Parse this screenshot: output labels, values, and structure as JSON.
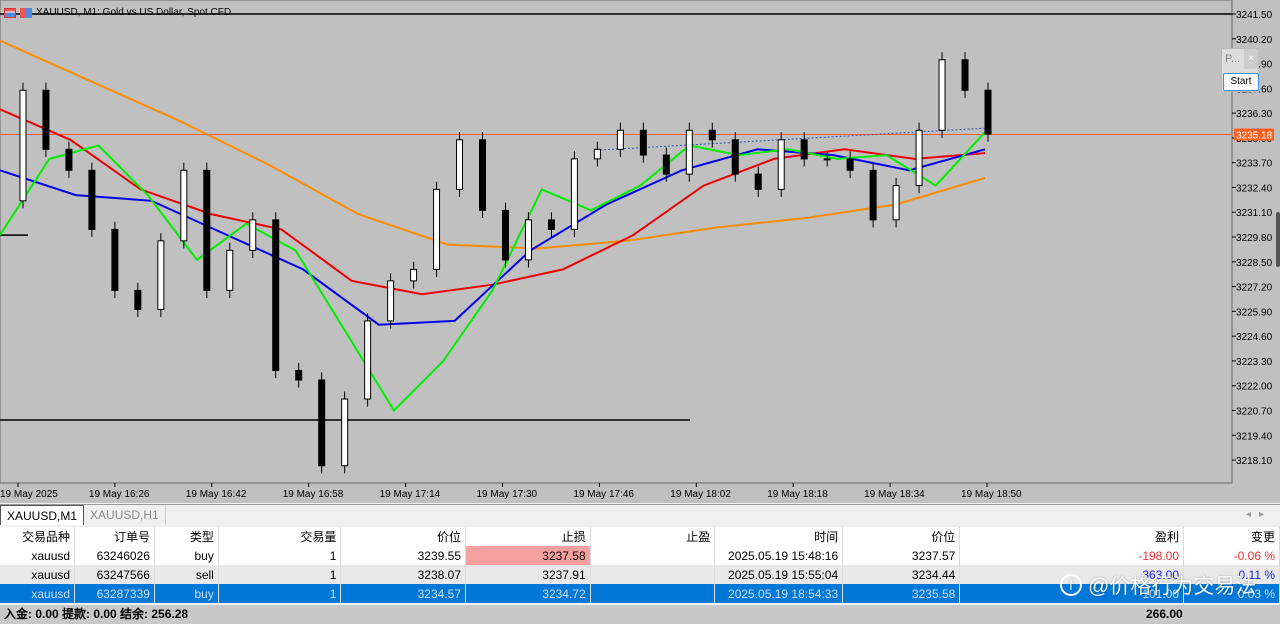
{
  "chart_title": "XAUUSD, M1:  Gold vs US Dollar, Spot CFD",
  "panel": {
    "title": "P...",
    "close": "×",
    "start": "Start"
  },
  "chart_data": {
    "type": "candlestick",
    "symbol": "XAUUSD",
    "timeframe": "M1",
    "ylim": [
      3217.5,
      3241.8
    ],
    "y_ticks": [
      "3241.50",
      "3240.20",
      "3238.90",
      "3237.60",
      "3236.30",
      "3235.00",
      "3233.70",
      "3232.40",
      "3231.10",
      "3229.80",
      "3228.50",
      "3227.20",
      "3225.90",
      "3224.60",
      "3223.30",
      "3222.00",
      "3220.70",
      "3219.40",
      "3218.10"
    ],
    "x_ticks": [
      "19 May 2025",
      "19 May 16:26",
      "19 May 16:42",
      "19 May 16:58",
      "19 May 17:14",
      "19 May 17:30",
      "19 May 17:46",
      "19 May 18:02",
      "19 May 18:18",
      "19 May 18:34",
      "19 May 18:50"
    ],
    "current_price": "3235.18",
    "closes": [
      3231.7,
      3237.5,
      3234.4,
      3233.3,
      3230.2,
      3227.0,
      3226.0,
      3229.6,
      3233.3,
      3227.0,
      3229.1,
      3230.7,
      3222.8,
      3222.3,
      3217.8,
      3221.3,
      3225.4,
      3227.5,
      3228.1,
      3232.3,
      3234.9,
      3231.2,
      3228.6,
      3230.7,
      3230.2,
      3233.9,
      3234.4,
      3235.4,
      3234.1,
      3233.1,
      3235.4,
      3234.9,
      3233.1,
      3232.3,
      3234.9,
      3233.9,
      3233.9,
      3233.3,
      3230.7,
      3232.5,
      3235.4,
      3239.1,
      3237.5,
      3235.2
    ],
    "moving_averages": [
      {
        "color": "#ff8c00",
        "values": [
          3240.1,
          3238.0,
          3235.9,
          3233.6,
          3231.0,
          3229.4,
          3229.2,
          3229.6,
          3230.3,
          3230.8,
          3231.5,
          3232.9
        ]
      },
      {
        "color": "#ee0000",
        "values": [
          3236.5,
          3234.9,
          3232.3,
          3231.0,
          3230.2,
          3227.5,
          3226.8,
          3227.3,
          3228.1,
          3229.9,
          3232.5,
          3233.9,
          3234.4,
          3233.9,
          3234.2
        ]
      },
      {
        "color": "#0000ee",
        "values": [
          3233.3,
          3232.0,
          3231.7,
          3229.9,
          3228.1,
          3225.2,
          3225.4,
          3229.1,
          3231.5,
          3233.3,
          3234.4,
          3234.1,
          3233.3,
          3234.4
        ]
      },
      {
        "color": "#00ee00",
        "values": [
          3229.9,
          3233.9,
          3234.6,
          3232.0,
          3228.6,
          3230.5,
          3229.1,
          3224.9,
          3220.7,
          3223.3,
          3227.0,
          3232.3,
          3231.2,
          3232.5,
          3234.6,
          3234.1,
          3234.4,
          3233.9,
          3234.1,
          3232.5,
          3235.3
        ]
      }
    ],
    "horizontal_lines": [
      3241.5,
      3229.9,
      3220.2
    ]
  },
  "tabs": [
    "XAUUSD,M1",
    "XAUUSD,H1"
  ],
  "table": {
    "headers": [
      "交易品种",
      "订单号",
      "类型",
      "交易量",
      "价位",
      "止损",
      "止盈",
      "时间",
      "价位",
      "盈利",
      "变更"
    ],
    "rows": [
      [
        "xauusd",
        "63246026",
        "buy",
        "1",
        "3239.55",
        "3237.58",
        "",
        "2025.05.19 15:48:16",
        "3237.57",
        "-198.00",
        "-0.06 %"
      ],
      [
        "xauusd",
        "63247566",
        "sell",
        "1",
        "3238.07",
        "3237.91",
        "",
        "2025.05.19 15:55:04",
        "3234.44",
        "363.00",
        "0.11 %"
      ],
      [
        "xauusd",
        "63287339",
        "buy",
        "1",
        "3234.57",
        "3234.72",
        "",
        "2025.05.19 18:54:33",
        "3235.58",
        "101.00",
        "0.03 %"
      ]
    ]
  },
  "footer": {
    "summary": "入金: 0.00  提款: 0.00  结余: 256.28",
    "total": "266.00"
  },
  "watermark": "@价格行为交易法"
}
